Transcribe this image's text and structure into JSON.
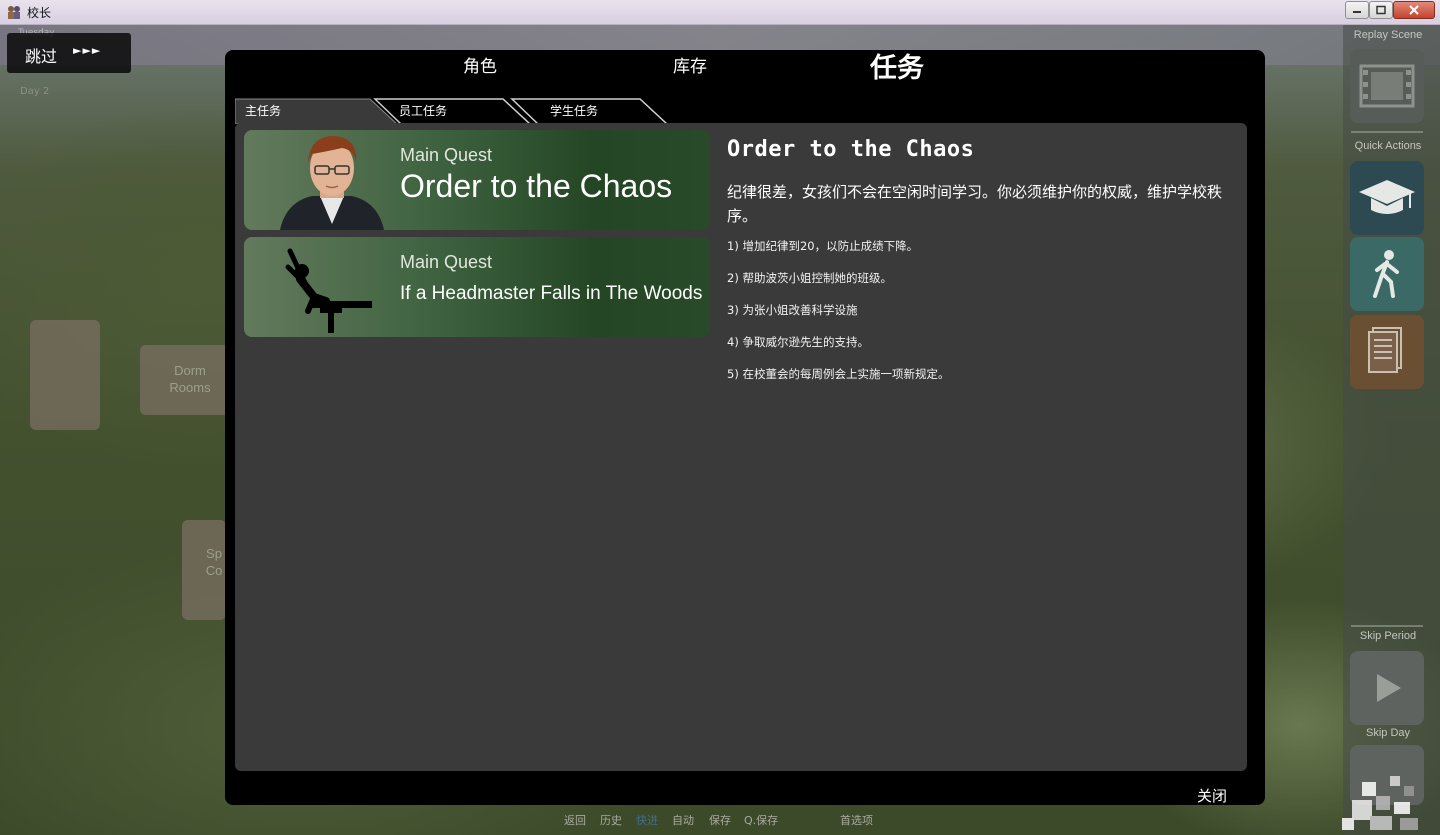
{
  "window": {
    "title": "校长"
  },
  "hud": {
    "skip_label": "跳过",
    "skip_arrows": "►►►",
    "day_label": "Day 2",
    "weekday_label": "Tuesday"
  },
  "map": {
    "dorm_label_1": "Dorm",
    "dorm_label_2": "Rooms",
    "sp_label_1": "Sp",
    "sp_label_2": "Co"
  },
  "sidebar": {
    "replay_title": "Replay Scene",
    "quick_title": "Quick Actions",
    "skip_period_title": "Skip Period",
    "skip_day_title": "Skip Day",
    "colors": {
      "graduate": "#2d4a52",
      "walk": "#3b6a66",
      "notes": "#6a4f33"
    }
  },
  "tabs": {
    "characters": "角色",
    "inventory": "库存",
    "quests": "任务"
  },
  "subtabs": {
    "main": "主任务",
    "staff": "员工任务",
    "student": "学生任务"
  },
  "quests": [
    {
      "type": "Main Quest",
      "title": "Order to the Chaos",
      "icon": "portrait-icon"
    },
    {
      "type": "Main Quest",
      "title": "If a Headmaster Falls in The Woods",
      "icon": "falling-person-icon"
    }
  ],
  "detail": {
    "title": "Order to the Chaos",
    "description": "纪律很差，女孩们不会在空闲时间学习。你必须维护你的权威，维护学校秩序。",
    "objectives": [
      "1) 增加纪律到20，以防止成绩下降。",
      "2) 帮助波茨小姐控制她的班级。",
      "3) 为张小姐改善科学设施",
      "4) 争取威尔逊先生的支持。",
      "5) 在校董会的每周例会上实施一项新规定。"
    ]
  },
  "close_label": "关闭",
  "bottom_menu": {
    "back": "返回",
    "history": "历史",
    "skip": "快进",
    "auto": "自动",
    "save": "保存",
    "qsave": "Q.保存",
    "prefs": "首选项"
  }
}
